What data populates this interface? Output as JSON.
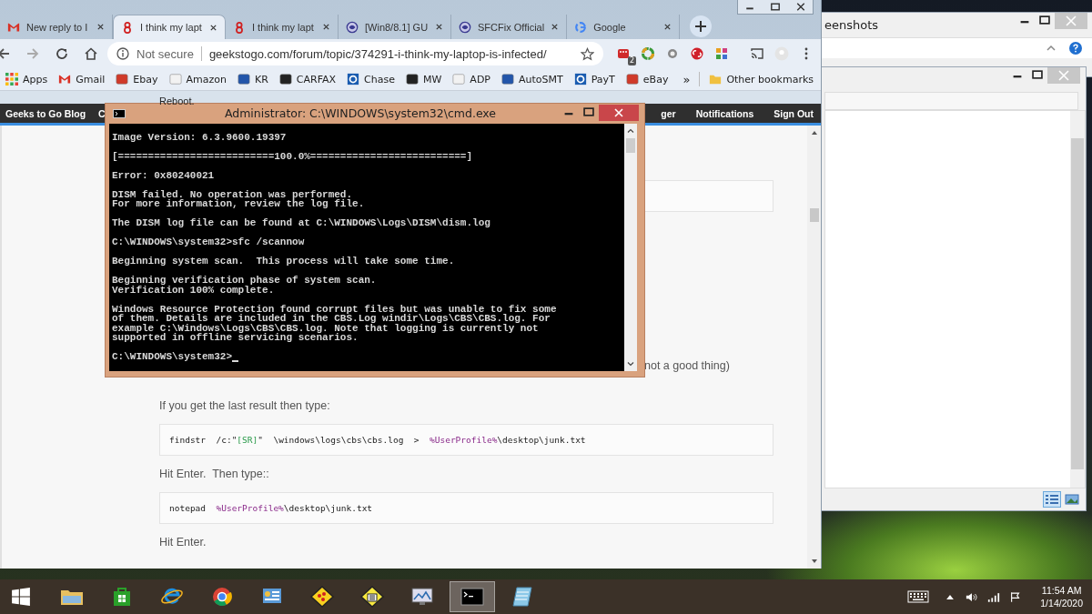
{
  "explorer_window": {
    "title": "eenshots"
  },
  "browser": {
    "tabs": [
      {
        "label": "New reply to I",
        "kind": "mail",
        "selected": false
      },
      {
        "label": "I think my lapt",
        "kind": "g2g",
        "selected": true
      },
      {
        "label": "I think my lapt",
        "kind": "g2g",
        "selected": false
      },
      {
        "label": "[Win8/8.1] GU",
        "kind": "bleeping",
        "selected": false
      },
      {
        "label": "SFCFix Official",
        "kind": "bleeping",
        "selected": false
      },
      {
        "label": "Google",
        "kind": "google",
        "selected": false
      }
    ],
    "security": "Not secure",
    "url": "geekstogo.com/forum/topic/374291-i-think-my-laptop-is-infected/",
    "extension_badge": "2",
    "bookmarks": [
      {
        "label": "Apps",
        "kind": "apps"
      },
      {
        "label": "Gmail",
        "kind": "mail"
      },
      {
        "label": "Ebay",
        "kind": "shop"
      },
      {
        "label": "Amazon",
        "kind": "light"
      },
      {
        "label": "KR",
        "kind": "blue"
      },
      {
        "label": "CARFAX",
        "kind": "dark"
      },
      {
        "label": "Chase",
        "kind": "ring"
      },
      {
        "label": "MW",
        "kind": "dark"
      },
      {
        "label": "ADP",
        "kind": "light"
      },
      {
        "label": "AutoSMT",
        "kind": "blue"
      },
      {
        "label": "PayT",
        "kind": "ring"
      },
      {
        "label": "eBay",
        "kind": "shop"
      }
    ],
    "more_bookmarks": "»",
    "other_bookmarks": "Other bookmarks",
    "page": {
      "partial_heading": "Reboot.",
      "nav_left": [
        "Geeks to Go Blog",
        "C"
      ],
      "nav_right": [
        "ger",
        "Notifications",
        "Sign Out"
      ],
      "partial_text": "not a good thing)",
      "blocks": [
        {
          "kind": "text",
          "text": "If you get the last result then type:"
        },
        {
          "kind": "code",
          "parts": [
            {
              "text": "findstr  /c:\"",
              "kind": "plain"
            },
            {
              "text": "[SR]",
              "kind": "string"
            },
            {
              "text": "\"  \\windows\\logs\\cbs\\cbs.log  >  ",
              "kind": "plain"
            },
            {
              "text": "%UserProfile%",
              "kind": "var"
            },
            {
              "text": "\\desktop\\junk.txt",
              "kind": "plain"
            }
          ]
        },
        {
          "kind": "text",
          "text": "Hit Enter.  Then type::"
        },
        {
          "kind": "code",
          "parts": [
            {
              "text": "notepad  ",
              "kind": "plain"
            },
            {
              "text": "%UserProfile%",
              "kind": "var"
            },
            {
              "text": "\\desktop\\junk.txt",
              "kind": "plain"
            }
          ]
        },
        {
          "kind": "text",
          "text": "Hit Enter."
        }
      ]
    }
  },
  "console": {
    "title": "Administrator: C:\\WINDOWS\\system32\\cmd.exe",
    "paragraphs": [
      [
        "Image Version: 6.3.9600.19397"
      ],
      [
        "[==========================100.0%==========================]"
      ],
      [
        "Error: 0x80240021"
      ],
      [
        "DISM failed. No operation was performed.",
        "For more information, review the log file."
      ],
      [
        "The DISM log file can be found at C:\\WINDOWS\\Logs\\DISM\\dism.log"
      ],
      [
        "C:\\WINDOWS\\system32>sfc /scannow"
      ],
      [
        "Beginning system scan.  This process will take some time."
      ],
      [
        "Beginning verification phase of system scan.",
        "Verification 100% complete."
      ],
      [
        "Windows Resource Protection found corrupt files but was unable to fix some",
        "of them. Details are included in the CBS.Log windir\\Logs\\CBS\\CBS.log. For",
        "example C:\\Windows\\Logs\\CBS\\CBS.log. Note that logging is currently not",
        "supported in offline servicing scenarios."
      ]
    ],
    "prompt": "C:\\WINDOWS\\system32>"
  },
  "taskbar": {
    "apps": [
      {
        "kind": "explorer",
        "selected": false
      },
      {
        "kind": "store",
        "selected": false
      },
      {
        "kind": "ie",
        "selected": false
      },
      {
        "kind": "chrome",
        "selected": false
      },
      {
        "kind": "panel",
        "selected": false
      },
      {
        "kind": "diamond",
        "selected": false
      },
      {
        "kind": "calc",
        "selected": false
      },
      {
        "kind": "monitor",
        "selected": false
      },
      {
        "kind": "cmd",
        "selected": true
      },
      {
        "kind": "notepad",
        "selected": false
      }
    ],
    "time": "11:54 AM",
    "date": "1/14/2020"
  }
}
